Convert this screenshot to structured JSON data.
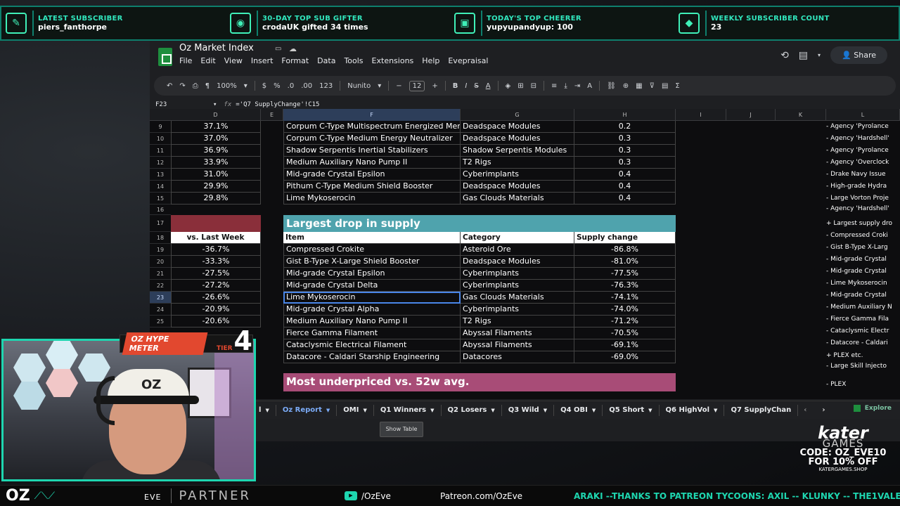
{
  "top_bar": [
    {
      "title": "LATEST SUBSCRIBER",
      "value": "piers_fanthorpe",
      "icon": "signature-icon"
    },
    {
      "title": "30-DAY TOP SUB GIFTER",
      "value": "crodaUK gifted 34 times",
      "icon": "camera-icon"
    },
    {
      "title": "TODAY'S TOP CHEERER",
      "value": "yupyupandyup: 100",
      "icon": "money-icon"
    },
    {
      "title": "WEEKLY SUBSCRIBER COUNT",
      "value": "23",
      "icon": "gem-icon"
    }
  ],
  "doc": {
    "title": "Oz Market Index",
    "menus": [
      "File",
      "Edit",
      "View",
      "Insert",
      "Format",
      "Data",
      "Tools",
      "Extensions",
      "Help",
      "Evepraisal"
    ],
    "share": "Share"
  },
  "toolbar": {
    "zoom": "100%",
    "currency": "$",
    "percent": "%",
    "dec_dec": ".0",
    "dec_inc": ".00",
    "format123": "123",
    "font": "Nunito",
    "font_size": "12"
  },
  "formula_bar": {
    "cell_ref": "F23",
    "fx": "fx",
    "formula": "='Q7 SupplyChange'!C15"
  },
  "columns": [
    "D",
    "E",
    "F",
    "G",
    "H",
    "I",
    "J",
    "K",
    "L"
  ],
  "rows": [
    "9",
    "10",
    "11",
    "12",
    "13",
    "14",
    "15",
    "16",
    "17",
    "18",
    "19",
    "20",
    "21",
    "22",
    "23",
    "24",
    "25"
  ],
  "top_table": {
    "d": [
      "37.1%",
      "37.0%",
      "36.9%",
      "33.9%",
      "31.0%",
      "29.9%",
      "29.8%"
    ],
    "items": [
      "Corpum C-Type Multispectrum Energized Membr",
      "Corpum C-Type Medium Energy Neutralizer",
      "Shadow Serpentis Inertial Stabilizers",
      "Medium Auxiliary Nano Pump II",
      "Mid-grade Crystal Epsilon",
      "Pithum C-Type Medium Shield Booster",
      "Lime Mykoserocin"
    ],
    "categories": [
      "Deadspace Modules",
      "Deadspace Modules",
      "Shadow Serpentis Modules",
      "T2 Rigs",
      "Cyberimplants",
      "Deadspace Modules",
      "Gas Clouds Materials"
    ],
    "values": [
      "0.2",
      "0.3",
      "0.3",
      "0.3",
      "0.4",
      "0.4",
      "0.4"
    ]
  },
  "drop_table": {
    "title": "Largest drop in supply",
    "headers": {
      "item": "Item",
      "category": "Category",
      "change": "Supply change"
    },
    "rows": [
      {
        "item": "Compressed Crokite",
        "category": "Asteroid Ore",
        "change": "-86.8%"
      },
      {
        "item": "Gist B-Type X-Large Shield Booster",
        "category": "Deadspace Modules",
        "change": "-81.0%"
      },
      {
        "item": "Mid-grade Crystal Epsilon",
        "category": "Cyberimplants",
        "change": "-77.5%"
      },
      {
        "item": "Mid-grade Crystal Delta",
        "category": "Cyberimplants",
        "change": "-76.3%"
      },
      {
        "item": "Lime Mykoserocin",
        "category": "Gas Clouds Materials",
        "change": "-74.1%"
      },
      {
        "item": "Mid-grade Crystal Alpha",
        "category": "Cyberimplants",
        "change": "-74.0%"
      },
      {
        "item": "Medium Auxiliary Nano Pump II",
        "category": "T2 Rigs",
        "change": "-71.2%"
      },
      {
        "item": "Fierce Gamma Filament",
        "category": "Abyssal Filaments",
        "change": "-70.5%"
      },
      {
        "item": "Cataclysmic Electrical Filament",
        "category": "Abyssal Filaments",
        "change": "-69.1%"
      },
      {
        "item": "Datacore - Caldari Starship Engineering",
        "category": "Datacores",
        "change": "-69.0%"
      }
    ]
  },
  "left_table": {
    "header": "vs. Last Week",
    "values": [
      "-36.7%",
      "-33.3%",
      "-27.5%",
      "-27.2%",
      "-26.6%",
      "-20.9%",
      "-20.6%"
    ]
  },
  "next_section": "Most underpriced vs. 52w avg.",
  "col_l": [
    "- Agency 'Pyrolance",
    "- Agency 'Hardshell'",
    "- Agency 'Pyrolance",
    "- Agency 'Overclock",
    "- Drake Navy Issue",
    "- High-grade Hydra",
    "- Large Vorton Proje",
    "- Agency 'Hardshell'",
    "+ Largest supply dro",
    "- Compressed Croki",
    "- Gist B-Type X-Larg",
    "- Mid-grade Crystal",
    "- Mid-grade Crystal",
    "- Lime Mykoserocin",
    "- Mid-grade Crystal",
    "- Medium Auxiliary N",
    "- Fierce Gamma Fila",
    "- Cataclysmic Electr",
    "- Datacore - Caldari",
    "+ PLEX etc.",
    "- Large Skill Injecto",
    "- PLEX"
  ],
  "tabs": [
    "l",
    "Oz Report",
    "OMI",
    "Q1 Winners",
    "Q2 Losers",
    "Q3 Wild",
    "Q4 OBI",
    "Q5 Short",
    "Q6 HighVol",
    "Q7 SupplyChan"
  ],
  "explore": "Explore",
  "show_table": "Show Table",
  "hype": {
    "label": "OZ HYPE METER",
    "tier_label": "TIER",
    "tier": "4"
  },
  "bottom": {
    "logo": "OZ",
    "eve": "EVE",
    "partner": "PARTNER",
    "youtube": "/OzEve",
    "patreon": "Patreon.com/OzEve",
    "ticker": "ARAKI --THANKS TO PATREON TYCOONS: AXIL -- KLUNKY -- THE1VALENTI"
  },
  "kater": {
    "logo": "kater",
    "sub": "GAMES",
    "code1": "CODE: OZ_EVE10",
    "code2": "FOR 10% OFF",
    "shop": "KATERGAMES.SHOP"
  },
  "colors": {
    "accent": "#1ed6b0",
    "teal_header": "#4fa3ad",
    "maroon": "#8a2f3a",
    "pink_header": "#a84c77"
  }
}
